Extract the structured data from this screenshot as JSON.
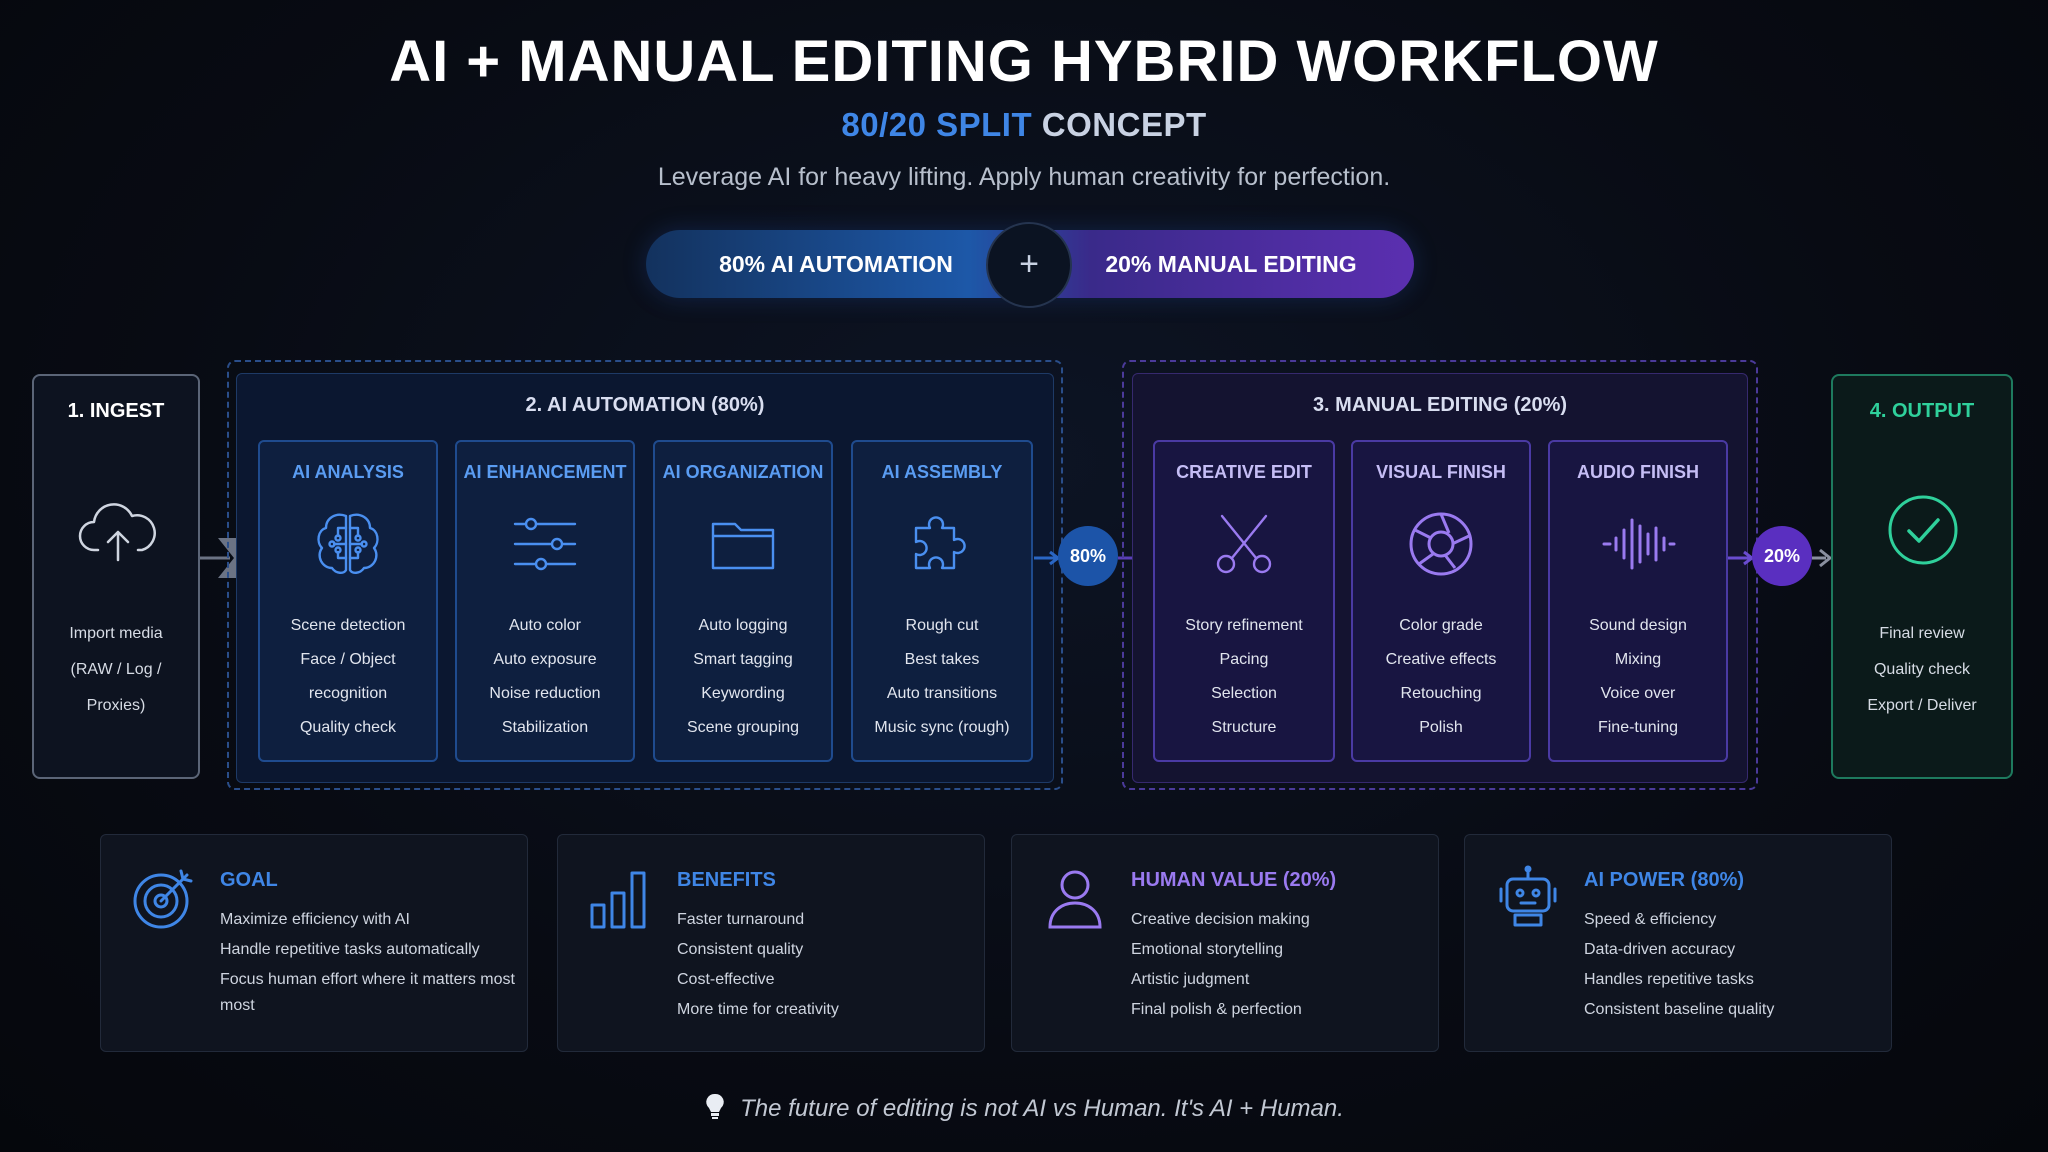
{
  "title": "AI + MANUAL EDITING HYBRID WORKFLOW",
  "subtitle": {
    "highlight": "80/20 SPLIT",
    "rest": "CONCEPT"
  },
  "tagline": "Leverage AI for heavy lifting. Apply human creativity for perfection.",
  "split": {
    "left": "80% AI AUTOMATION",
    "plus": "+",
    "right": "20% MANUAL EDITING"
  },
  "ingest": {
    "title": "1. INGEST",
    "icon": "cloud-upload-icon",
    "lines": [
      "Import media",
      "(RAW / Log /",
      "Proxies)"
    ]
  },
  "ai_group": {
    "title": "2. AI AUTOMATION (80%)",
    "cards": [
      {
        "title": "AI ANALYSIS",
        "icon": "brain-icon",
        "items": [
          "Scene detection",
          "Face / Object",
          "recognition",
          "Quality check"
        ]
      },
      {
        "title": "AI ENHANCEMENT",
        "icon": "sliders-icon",
        "items": [
          "Auto color",
          "Auto exposure",
          "Noise reduction",
          "Stabilization"
        ]
      },
      {
        "title": "AI ORGANIZATION",
        "icon": "folder-icon",
        "items": [
          "Auto logging",
          "Smart tagging",
          "Keywording",
          "Scene grouping"
        ]
      },
      {
        "title": "AI ASSEMBLY",
        "icon": "puzzle-icon",
        "items": [
          "Rough cut",
          "Best takes",
          "Auto transitions",
          "Music sync (rough)"
        ]
      }
    ]
  },
  "badges": {
    "ai": "80%",
    "manual": "20%"
  },
  "manual_group": {
    "title": "3. MANUAL EDITING (20%)",
    "cards": [
      {
        "title": "CREATIVE EDIT",
        "icon": "scissors-icon",
        "items": [
          "Story refinement",
          "Pacing",
          "Selection",
          "Structure"
        ]
      },
      {
        "title": "VISUAL FINISH",
        "icon": "aperture-icon",
        "items": [
          "Color grade",
          "Creative effects",
          "Retouching",
          "Polish"
        ]
      },
      {
        "title": "AUDIO FINISH",
        "icon": "waveform-icon",
        "items": [
          "Sound design",
          "Mixing",
          "Voice over",
          "Fine-tuning"
        ]
      }
    ]
  },
  "output": {
    "title": "4. OUTPUT",
    "icon": "check-circle-icon",
    "lines": [
      "Final review",
      "Quality check",
      "Export / Deliver"
    ]
  },
  "panels": [
    {
      "title": "GOAL",
      "icon": "target-icon",
      "color": "#3f86e6",
      "items": [
        "Maximize efficiency with AI",
        "Handle repetitive tasks automatically",
        "Focus human effort where it matters most most"
      ]
    },
    {
      "title": "BENEFITS",
      "icon": "bar-chart-icon",
      "color": "#3f86e6",
      "items": [
        "Faster turnaround",
        "Consistent quality",
        "Cost-effective",
        "More time for creativity"
      ]
    },
    {
      "title": "HUMAN VALUE (20%)",
      "icon": "person-icon",
      "color": "#9a7af0",
      "items": [
        "Creative decision making",
        "Emotional storytelling",
        "Artistic judgment",
        "Final polish & perfection"
      ]
    },
    {
      "title": "AI POWER (80%)",
      "icon": "robot-icon",
      "color": "#3f86e6",
      "items": [
        "Speed & efficiency",
        "Data-driven accuracy",
        "Handles repetitive tasks",
        "Consistent baseline quality"
      ]
    }
  ],
  "footer": "The future of editing is not AI vs Human. It's AI + Human."
}
